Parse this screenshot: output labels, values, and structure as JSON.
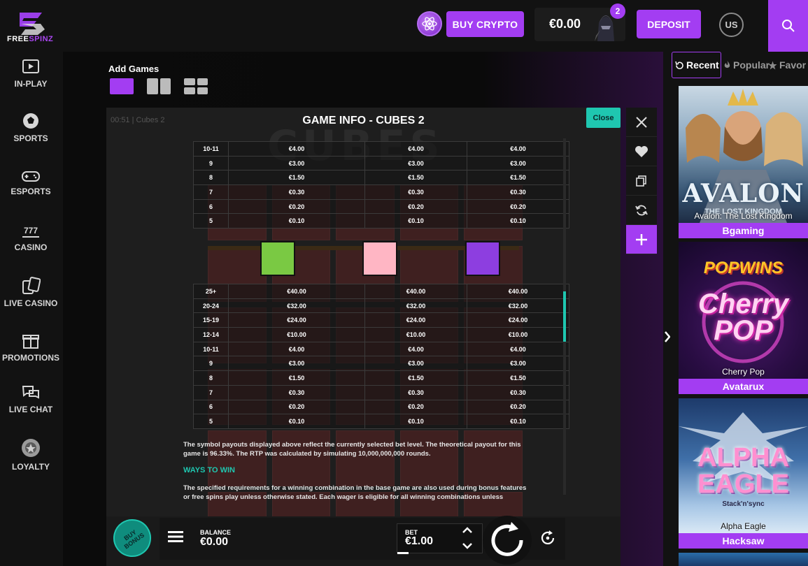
{
  "brand": {
    "name_a": "FREE",
    "name_b": "SPINZ"
  },
  "header": {
    "buy_crypto": "BUY CRYPTO",
    "balance": "€0.00",
    "notifications": "2",
    "deposit": "DEPOSIT",
    "language": "US"
  },
  "sidebar": {
    "items": [
      {
        "label": "IN-PLAY",
        "icon": "play-icon"
      },
      {
        "label": "SPORTS",
        "icon": "soccer-ball-icon"
      },
      {
        "label": "ESPORTS",
        "icon": "gamepad-icon"
      },
      {
        "label": "CASINO",
        "icon": "slot-777-icon"
      },
      {
        "label": "LIVE CASINO",
        "icon": "cards-icon"
      },
      {
        "label": "PROMOTIONS",
        "icon": "gift-icon"
      },
      {
        "label": "LIVE CHAT",
        "icon": "chat-icon"
      },
      {
        "label": "LOYALTY",
        "icon": "loyalty-icon"
      }
    ]
  },
  "stage": {
    "add_games": "Add Games"
  },
  "game": {
    "time": "00:51 | Cubes 2",
    "logo": "CUBES",
    "info_title": "GAME INFO - CUBES 2",
    "close": "Close",
    "table_top": [
      [
        "10-11",
        "€4.00",
        "€4.00",
        "€4.00"
      ],
      [
        "9",
        "€3.00",
        "€3.00",
        "€3.00"
      ],
      [
        "8",
        "€1.50",
        "€1.50",
        "€1.50"
      ],
      [
        "7",
        "€0.30",
        "€0.30",
        "€0.30"
      ],
      [
        "6",
        "€0.20",
        "€0.20",
        "€0.20"
      ],
      [
        "5",
        "€0.10",
        "€0.10",
        "€0.10"
      ]
    ],
    "swatch_colors": [
      "#7ac943",
      "#ffb6c4",
      "#8d3ee0"
    ],
    "table_bottom": [
      [
        "25+",
        "€40.00",
        "€40.00",
        "€40.00"
      ],
      [
        "20-24",
        "€32.00",
        "€32.00",
        "€32.00"
      ],
      [
        "15-19",
        "€24.00",
        "€24.00",
        "€24.00"
      ],
      [
        "12-14",
        "€10.00",
        "€10.00",
        "€10.00"
      ],
      [
        "10-11",
        "€4.00",
        "€4.00",
        "€4.00"
      ],
      [
        "9",
        "€3.00",
        "€3.00",
        "€3.00"
      ],
      [
        "8",
        "€1.50",
        "€1.50",
        "€1.50"
      ],
      [
        "7",
        "€0.30",
        "€0.30",
        "€0.30"
      ],
      [
        "6",
        "€0.20",
        "€0.20",
        "€0.20"
      ],
      [
        "5",
        "€0.10",
        "€0.10",
        "€0.10"
      ]
    ],
    "desc1": "The symbol payouts displayed above reflect the currently selected bet level. The theoretical payout for this game is 96.33%. The RTP was calculated by simulating 10,000,000,000 rounds.",
    "ways_heading": "WAYS TO WIN",
    "desc2": "The specified requirements for a winning combination in the base game are also used during bonus features or free spins play unless otherwise stated. Each wager is eligible for all winning combinations unless otherwise stated.",
    "buy_bonus": "BUY BONUS",
    "balance_label": "BALANCE",
    "balance_value": "€0.00",
    "bet_label": "BET",
    "bet_value": "€1.00"
  },
  "right_panel": {
    "tabs": {
      "recent": "Recent",
      "popular": "Popular",
      "favorites": "Favor"
    },
    "games": [
      {
        "title": "AVALON",
        "subtitle": "THE LOST KINGDOM",
        "overlay": "Avalon: The Lost Kingdom",
        "provider": "Bgaming"
      },
      {
        "title": "Cherry POP",
        "brand": "POPWINS",
        "overlay": "Cherry Pop",
        "provider": "Avatarux"
      },
      {
        "title": "ALPHA EAGLE",
        "subtitle": "Stack'n'sync",
        "overlay": "Alpha Eagle",
        "provider": "Hacksaw"
      }
    ]
  }
}
